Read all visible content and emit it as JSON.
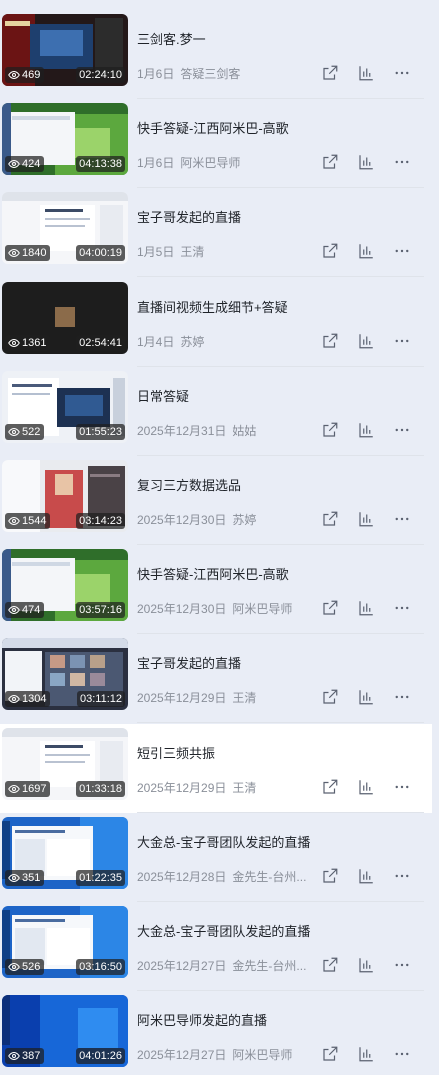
{
  "videos": [
    {
      "title": "三剑客.梦一",
      "date": "1月6日",
      "author": "答疑三剑客",
      "views": "469",
      "duration": "02:24:10",
      "thumb_theme": "dark-red"
    },
    {
      "title": "快手答疑-江西阿米巴-高歌",
      "date": "1月6日",
      "author": "阿米巴导师",
      "views": "424",
      "duration": "04:13:38",
      "thumb_theme": "green-desktop"
    },
    {
      "title": "宝子哥发起的直播",
      "date": "1月5日",
      "author": "王清",
      "views": "1840",
      "duration": "04:00:19",
      "thumb_theme": "white-doc"
    },
    {
      "title": "直播间视频生成细节+答疑",
      "date": "1月4日",
      "author": "苏婷",
      "views": "1361",
      "duration": "02:54:41",
      "thumb_theme": "black-avatar"
    },
    {
      "title": "日常答疑",
      "date": "2025年12月31日",
      "author": "姑姑",
      "views": "522",
      "duration": "01:55:23",
      "thumb_theme": "doc-dialog"
    },
    {
      "title": "复习三方数据选品",
      "date": "2025年12月30日",
      "author": "苏婷",
      "views": "1544",
      "duration": "03:14:23",
      "thumb_theme": "person"
    },
    {
      "title": "快手答疑-江西阿米巴-高歌",
      "date": "2025年12月30日",
      "author": "阿米巴导师",
      "views": "474",
      "duration": "03:57:16",
      "thumb_theme": "green-desktop"
    },
    {
      "title": "宝子哥发起的直播",
      "date": "2025年12月29日",
      "author": "王清",
      "views": "1304",
      "duration": "03:11:12",
      "thumb_theme": "grid"
    },
    {
      "title": "短引三频共振",
      "date": "2025年12月29日",
      "author": "王清",
      "views": "1697",
      "duration": "01:33:18",
      "thumb_theme": "white-doc"
    },
    {
      "title": "大金总-宝子哥团队发起的直播",
      "date": "2025年12月28日",
      "author": "金先生-台州...",
      "views": "351",
      "duration": "01:22:35",
      "thumb_theme": "blue-desktop"
    },
    {
      "title": "大金总-宝子哥团队发起的直播",
      "date": "2025年12月27日",
      "author": "金先生-台州...",
      "views": "526",
      "duration": "03:16:50",
      "thumb_theme": "blue-desktop"
    },
    {
      "title": "阿米巴导师发起的直播",
      "date": "2025年12月27日",
      "author": "阿米巴导师",
      "views": "387",
      "duration": "04:01:26",
      "thumb_theme": "win-blue"
    }
  ],
  "active_index": 8,
  "colors": {
    "background": "#e9edf6",
    "active_row": "#ffffff",
    "title": "#1f2329",
    "meta": "#8a8f99",
    "icon": "#5a6170"
  },
  "icons": {
    "views": "eye-icon",
    "share": "share-icon",
    "stats": "bar-chart-icon",
    "more": "more-icon"
  }
}
